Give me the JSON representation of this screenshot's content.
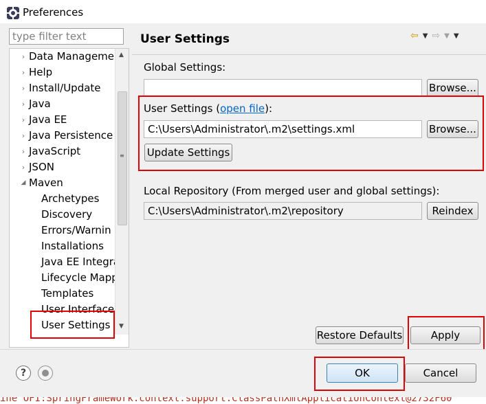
{
  "window": {
    "title": "Preferences"
  },
  "sidebar": {
    "filter_placeholder": "type filter text",
    "items": [
      {
        "label": "Data Manageme",
        "arrow": "›"
      },
      {
        "label": "Help",
        "arrow": "›"
      },
      {
        "label": "Install/Update",
        "arrow": "›"
      },
      {
        "label": "Java",
        "arrow": "›"
      },
      {
        "label": "Java EE",
        "arrow": "›"
      },
      {
        "label": "Java Persistence",
        "arrow": "›"
      },
      {
        "label": "JavaScript",
        "arrow": "›"
      },
      {
        "label": "JSON",
        "arrow": "›"
      },
      {
        "label": "Maven",
        "arrow": "◢"
      },
      {
        "label": "Archetypes"
      },
      {
        "label": "Discovery"
      },
      {
        "label": "Errors/Warnin"
      },
      {
        "label": "Installations"
      },
      {
        "label": "Java EE Integra"
      },
      {
        "label": "Lifecycle Mapp"
      },
      {
        "label": "Templates"
      },
      {
        "label": "User Interface"
      },
      {
        "label": "User Settings"
      }
    ]
  },
  "main": {
    "title": "User Settings",
    "global_label": "Global Settings:",
    "global_value": "",
    "browse_label": "Browse...",
    "user_label_prefix": "User Settings (",
    "user_link": "open file",
    "user_label_suffix": "):",
    "user_value": "C:\\Users\\Administrator\\.m2\\settings.xml",
    "update_button": "Update Settings",
    "local_label": "Local Repository (From merged user and global settings):",
    "local_value": "C:\\Users\\Administrator\\.m2\\repository",
    "reindex_button": "Reindex",
    "restore_button": "Restore Defaults",
    "apply_button": "Apply"
  },
  "footer": {
    "ok_button": "OK",
    "cancel_button": "Cancel"
  },
  "status_strip_text": "ine  OFI:SpringFrameWork.context.support.ClassPathXmlApplicationContext@2732F60"
}
